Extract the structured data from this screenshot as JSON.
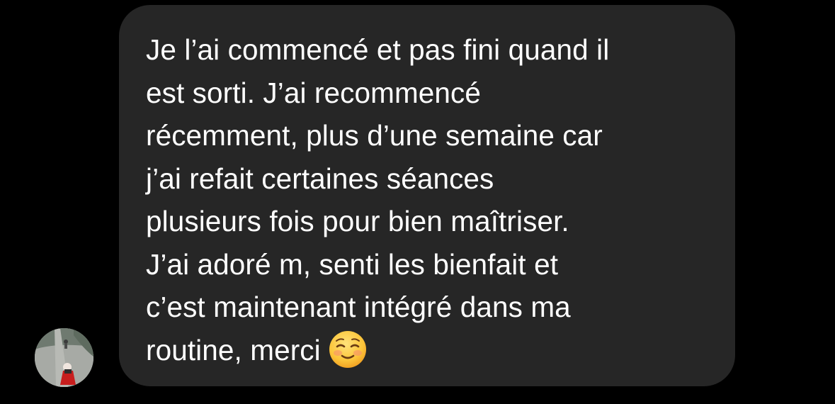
{
  "message": {
    "lines": [
      "Je l’ai commencé et pas fini quand il",
      "est sorti. J’ai recommencé",
      "récemment, plus d’une semaine car",
      "j’ai refait certaines séances",
      "plusieurs fois pour bien maîtriser.",
      "J’ai adoré m, senti les bienfait et",
      "c’est maintenant intégré dans ma",
      "routine, merci"
    ],
    "emoji": "smiling-face-emoji"
  },
  "sender": {
    "avatar_icon": "profile-photo-avatar"
  },
  "colors": {
    "background": "#000000",
    "bubble": "#262626",
    "text": "#ffffff"
  }
}
